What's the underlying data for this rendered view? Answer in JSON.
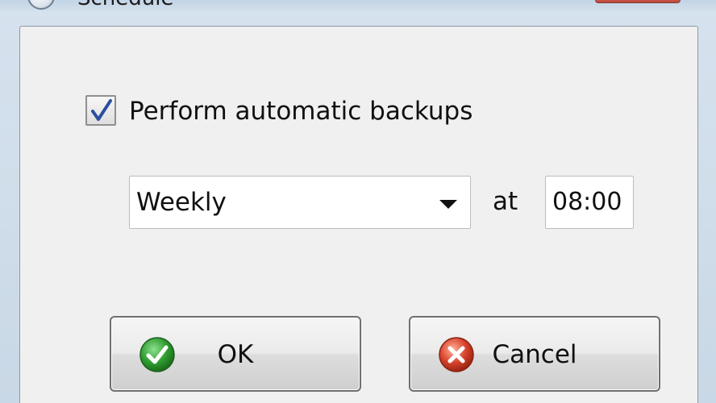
{
  "window": {
    "title": "Schedule"
  },
  "options": {
    "auto_backup_label": "Perform automatic backups",
    "auto_backup_checked": true
  },
  "schedule": {
    "frequency": "Weekly",
    "at_label": "at",
    "time": "08:00"
  },
  "buttons": {
    "ok_label": "OK",
    "ok_icon": "check-icon",
    "cancel_label": "Cancel",
    "cancel_icon": "cancel-icon"
  },
  "colors": {
    "ok_icon": "#2f9e2f",
    "cancel_icon": "#d8432c"
  }
}
